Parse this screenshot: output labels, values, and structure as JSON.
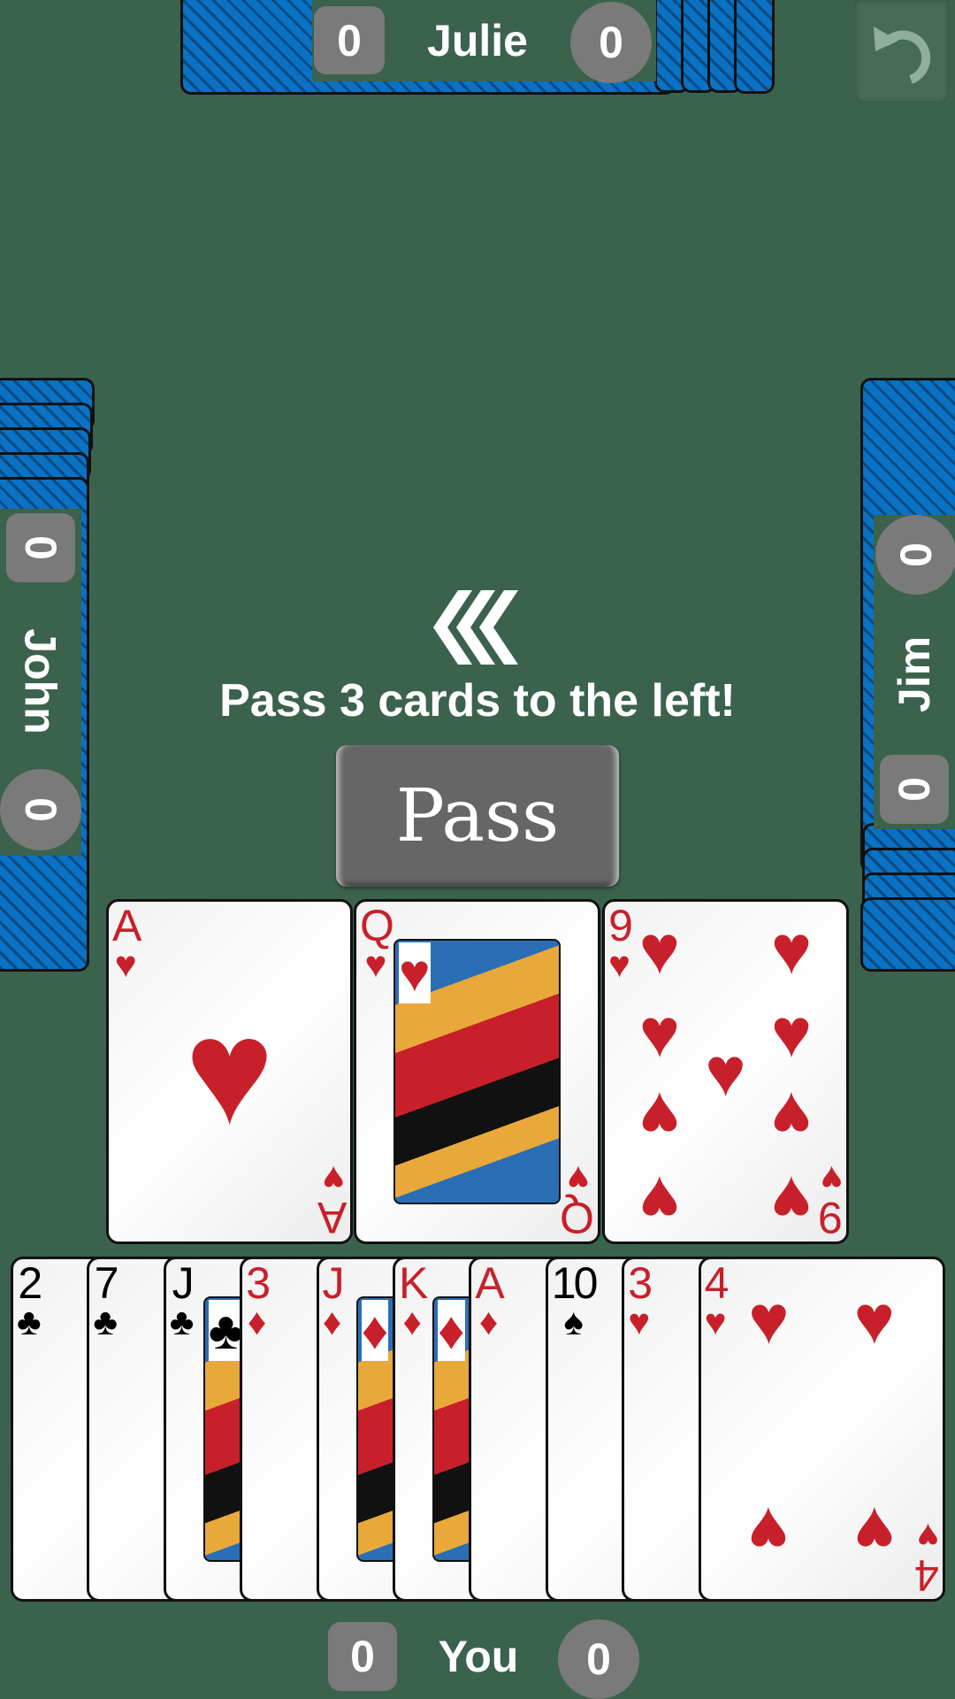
{
  "players": {
    "top": {
      "name": "Julie",
      "score_left": "0",
      "score_right": "0"
    },
    "left": {
      "name": "John",
      "score_top": "0",
      "score_bottom": "0"
    },
    "right": {
      "name": "Jim",
      "score_top": "0",
      "score_bottom": "0"
    },
    "bottom": {
      "name": "You",
      "score_left": "0",
      "score_right": "0"
    }
  },
  "undo_icon": "undo-arrow-icon",
  "pass_direction_icon": "triple-chevron-left-icon",
  "instruction": "Pass 3 cards to the left!",
  "pass_button_label": "Pass",
  "colors": {
    "table": "#3b624c",
    "card_back": "#0a72c4",
    "red_suit": "#c8202a",
    "badge": "#7a7a7a"
  },
  "selected_cards": [
    {
      "rank": "A",
      "suit": "♥",
      "color": "red"
    },
    {
      "rank": "Q",
      "suit": "♥",
      "color": "red"
    },
    {
      "rank": "9",
      "suit": "♥",
      "color": "red"
    }
  ],
  "hand": [
    {
      "rank": "2",
      "suit": "♣",
      "color": "black"
    },
    {
      "rank": "7",
      "suit": "♣",
      "color": "black"
    },
    {
      "rank": "J",
      "suit": "♣",
      "color": "black"
    },
    {
      "rank": "3",
      "suit": "♦",
      "color": "red"
    },
    {
      "rank": "J",
      "suit": "♦",
      "color": "red"
    },
    {
      "rank": "K",
      "suit": "♦",
      "color": "red"
    },
    {
      "rank": "A",
      "suit": "♦",
      "color": "red"
    },
    {
      "rank": "10",
      "suit": "♠",
      "color": "black"
    },
    {
      "rank": "3",
      "suit": "♥",
      "color": "red"
    },
    {
      "rank": "4",
      "suit": "♥",
      "color": "red"
    }
  ]
}
